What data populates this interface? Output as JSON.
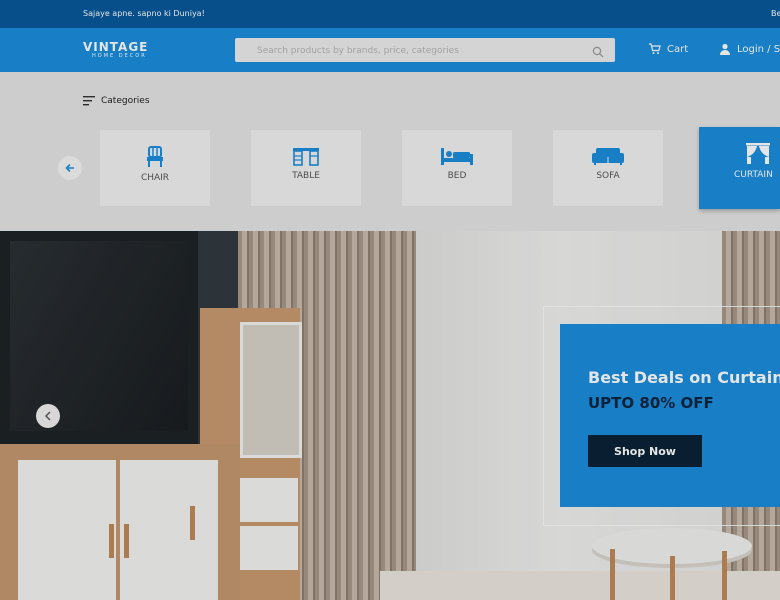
{
  "topbar": {
    "tagline": "Sajaye apne. sapno ki Duniya!",
    "right_text": "Be"
  },
  "header": {
    "logo": {
      "name": "VINTAGE",
      "subtitle": "HOME DECOR"
    },
    "search": {
      "placeholder": "Search products by brands, price, categories",
      "value": ""
    },
    "cart_label": "Cart",
    "login_label": "Login / S",
    "colors": {
      "topbar": "#07599a",
      "header": "#1b8ede"
    }
  },
  "categories": {
    "title": "Categories",
    "items": [
      {
        "label": "CHAIR",
        "icon": "chair-icon"
      },
      {
        "label": "TABLE",
        "icon": "table-icon"
      },
      {
        "label": "BED",
        "icon": "bed-icon"
      },
      {
        "label": "SOFA",
        "icon": "sofa-icon"
      },
      {
        "label": "CURTAIN",
        "icon": "curtain-icon",
        "active": true
      }
    ]
  },
  "hero": {
    "headline": "Best Deals on Curtains",
    "offer": "UPTO 80% OFF",
    "cta": "Shop Now",
    "accent": "#1b8ede"
  }
}
